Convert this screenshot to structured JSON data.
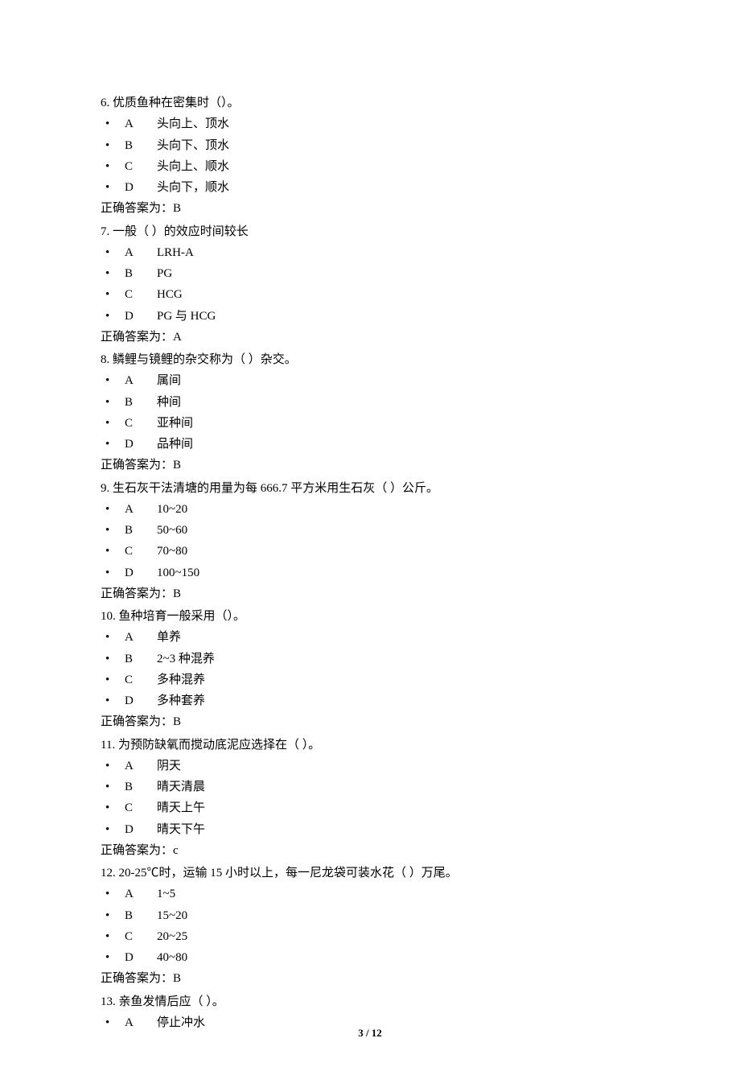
{
  "bullet": "•",
  "answer_label_prefix": "正确答案为：",
  "questions": [
    {
      "num": "6.",
      "text": "优质鱼种在密集时（）。",
      "options": [
        {
          "letter": "A",
          "text": "头向上、顶水"
        },
        {
          "letter": "B",
          "text": "头向下、顶水"
        },
        {
          "letter": "C",
          "text": "头向上、顺水"
        },
        {
          "letter": "D",
          "text": "头向下，顺水"
        }
      ],
      "answer": "B"
    },
    {
      "num": "7. ",
      "text": "一般（ ）的效应时间较长",
      "options": [
        {
          "letter": "A",
          "text": "LRH-A"
        },
        {
          "letter": "B",
          "text": "PG"
        },
        {
          "letter": "C",
          "text": "HCG"
        },
        {
          "letter": "D",
          "text": "PG 与 HCG"
        }
      ],
      "answer": "A"
    },
    {
      "num": "8. ",
      "text": "鳞鲤与镜鲤的杂交称为（ ）杂交。",
      "options": [
        {
          "letter": "A",
          "text": "属间"
        },
        {
          "letter": "B",
          "text": "种间"
        },
        {
          "letter": "C",
          "text": "亚种间"
        },
        {
          "letter": "D",
          "text": "品种间"
        }
      ],
      "answer": "B"
    },
    {
      "num": "9.",
      "text": "生石灰干法清塘的用量为每 666.7 平方米用生石灰（ ）公斤。",
      "options": [
        {
          "letter": "A",
          "text": "10~20"
        },
        {
          "letter": "B",
          "text": "50~60"
        },
        {
          "letter": "C",
          "text": "70~80"
        },
        {
          "letter": "D",
          "text": "100~150"
        }
      ],
      "answer": "B"
    },
    {
      "num": "10.",
      "text": "鱼种培育一般采用（）。",
      "options": [
        {
          "letter": "A",
          "text": "单养"
        },
        {
          "letter": "B",
          "text": "2~3 种混养"
        },
        {
          "letter": "C",
          "text": "多种混养"
        },
        {
          "letter": "D",
          "text": "多种套养"
        }
      ],
      "answer": "B"
    },
    {
      "num": "11.",
      "text": "为预防缺氧而搅动底泥应选择在（ ）。",
      "options": [
        {
          "letter": "A",
          "text": "阴天"
        },
        {
          "letter": "B",
          "text": "晴天清晨"
        },
        {
          "letter": "C",
          "text": "晴天上午"
        },
        {
          "letter": "D",
          "text": "晴天下午"
        }
      ],
      "answer": "c"
    },
    {
      "num": "12.",
      "text": "20-25℃时，运输 15 小时以上，每一尼龙袋可装水花（ ）万尾。",
      "options": [
        {
          "letter": "A",
          "text": "1~5"
        },
        {
          "letter": "B",
          "text": "15~20"
        },
        {
          "letter": "C",
          "text": "20~25"
        },
        {
          "letter": "D",
          "text": "40~80"
        }
      ],
      "answer": "B"
    },
    {
      "num": "13.",
      "text": "亲鱼发情后应（ ）。",
      "options": [
        {
          "letter": "A",
          "text": "停止冲水"
        }
      ],
      "answer": null
    }
  ],
  "page_number": "3 / 12"
}
